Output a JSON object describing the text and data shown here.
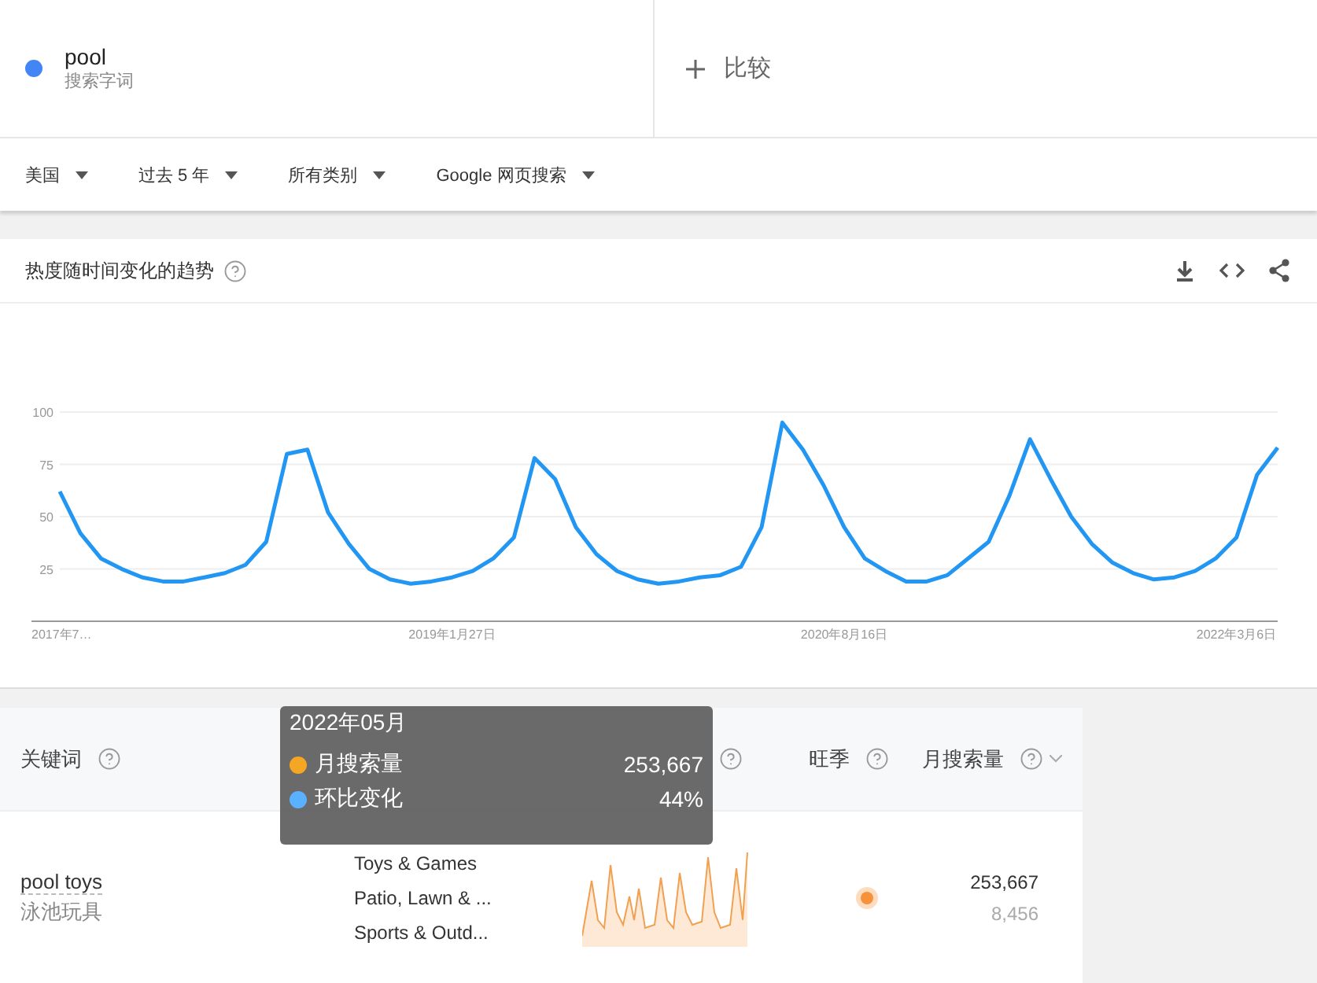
{
  "search_term": {
    "term": "pool",
    "subtitle": "搜索字词",
    "color": "#4285f4"
  },
  "compare": {
    "label": "比较"
  },
  "filters": [
    {
      "label": "美国"
    },
    {
      "label": "过去 5 年"
    },
    {
      "label": "所有类别"
    },
    {
      "label": "Google 网页搜索"
    }
  ],
  "trend_card": {
    "title": "热度随时间变化的趋势",
    "chart_data": {
      "type": "line",
      "categories": [
        "2017年7…",
        null,
        null,
        null,
        null,
        null,
        null,
        null,
        null,
        null,
        null,
        null,
        null,
        null,
        null,
        null,
        null,
        null,
        null,
        "2019年1月27日",
        null,
        null,
        null,
        null,
        null,
        null,
        null,
        null,
        null,
        null,
        null,
        null,
        null,
        null,
        null,
        null,
        null,
        null,
        "2020年8月16日",
        null,
        null,
        null,
        null,
        null,
        null,
        null,
        null,
        null,
        null,
        null,
        null,
        null,
        null,
        null,
        null,
        null,
        null,
        "2022年3月6日",
        null,
        null
      ],
      "series": [
        {
          "color": "#2196f3",
          "values": [
            62,
            42,
            30,
            25,
            21,
            19,
            19,
            21,
            23,
            27,
            38,
            80,
            82,
            52,
            37,
            25,
            20,
            18,
            19,
            21,
            24,
            30,
            40,
            78,
            68,
            45,
            32,
            24,
            20,
            18,
            19,
            21,
            22,
            26,
            45,
            95,
            82,
            65,
            45,
            30,
            24,
            19,
            19,
            22,
            30,
            38,
            60,
            87,
            68,
            50,
            37,
            28,
            23,
            20,
            21,
            24,
            30,
            40,
            70,
            83
          ]
        }
      ],
      "ylim": [
        0,
        100
      ],
      "yticks": [
        25,
        50,
        75,
        100
      ],
      "grid": true
    }
  },
  "table": {
    "columns": [
      {
        "kind": "labeled",
        "label": "关键词"
      },
      {
        "kind": "icon_only"
      },
      {
        "kind": "labeled",
        "label": "旺季"
      },
      {
        "kind": "labeled",
        "label": "月搜索量"
      }
    ],
    "rows": [
      {
        "keyword": "pool toys",
        "translation": "泳池玩具",
        "categories": [
          "Toys & Games",
          "Patio, Lawn & ...",
          "Sports & Outd..."
        ],
        "volume": "253,667",
        "secondary": "8,456"
      }
    ]
  },
  "tooltip": {
    "title": "2022年05月",
    "items": [
      {
        "label": "月搜索量",
        "value": "253,667",
        "color": "#f5a623"
      },
      {
        "label": "环比变化",
        "value": "44%",
        "color": "#5ab1ff"
      }
    ]
  }
}
